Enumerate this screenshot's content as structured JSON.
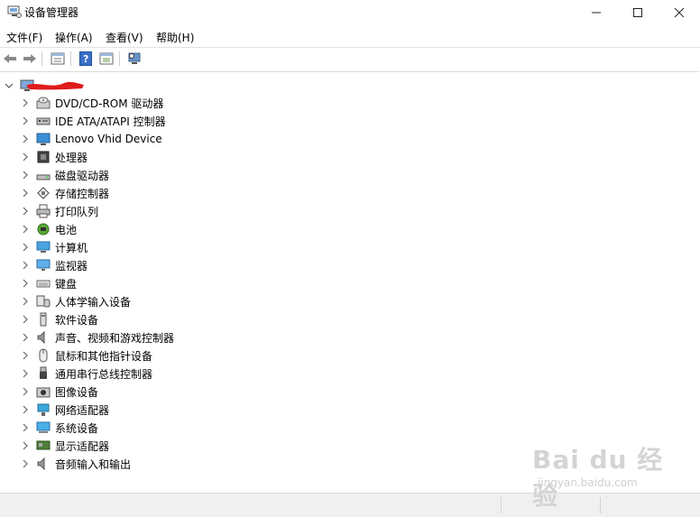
{
  "window": {
    "title": "设备管理器",
    "minimize": "—",
    "maximize": "☐",
    "close": "✕"
  },
  "menu": [
    {
      "label": "文件(F)"
    },
    {
      "label": "操作(A)"
    },
    {
      "label": "查看(V)"
    },
    {
      "label": "帮助(H)"
    }
  ],
  "toolbar": {
    "buttons": [
      "back-icon",
      "forward-icon",
      "properties-icon",
      "help-icon",
      "show-hidden-icon",
      "scan-hardware-icon"
    ]
  },
  "tree": {
    "root_expanded_glyph": "v",
    "collapsed_glyph": ">",
    "categories": [
      {
        "label": "DVD/CD-ROM 驱动器",
        "icon": "dvd-drive-icon"
      },
      {
        "label": "IDE ATA/ATAPI 控制器",
        "icon": "ide-controller-icon"
      },
      {
        "label": "Lenovo Vhid Device",
        "icon": "vhid-device-icon"
      },
      {
        "label": "处理器",
        "icon": "processor-icon"
      },
      {
        "label": "磁盘驱动器",
        "icon": "disk-drive-icon"
      },
      {
        "label": "存储控制器",
        "icon": "storage-controller-icon"
      },
      {
        "label": "打印队列",
        "icon": "printer-icon"
      },
      {
        "label": "电池",
        "icon": "battery-icon"
      },
      {
        "label": "计算机",
        "icon": "computer-icon"
      },
      {
        "label": "监视器",
        "icon": "monitor-icon"
      },
      {
        "label": "键盘",
        "icon": "keyboard-icon"
      },
      {
        "label": "人体学输入设备",
        "icon": "hid-icon"
      },
      {
        "label": "软件设备",
        "icon": "software-device-icon"
      },
      {
        "label": "声音、视频和游戏控制器",
        "icon": "sound-icon"
      },
      {
        "label": "鼠标和其他指针设备",
        "icon": "mouse-icon"
      },
      {
        "label": "通用串行总线控制器",
        "icon": "usb-icon"
      },
      {
        "label": "图像设备",
        "icon": "camera-icon"
      },
      {
        "label": "网络适配器",
        "icon": "network-icon"
      },
      {
        "label": "系统设备",
        "icon": "system-device-icon"
      },
      {
        "label": "显示适配器",
        "icon": "display-adapter-icon"
      },
      {
        "label": "音频输入和输出",
        "icon": "audio-io-icon"
      }
    ]
  },
  "watermark": {
    "brand": "Bai du 经验",
    "url": "jingyan.baidu.com"
  },
  "colors": {
    "redaction": "#e01b1b",
    "icon_blue": "#2b7cd3",
    "chevron": "#666666"
  }
}
